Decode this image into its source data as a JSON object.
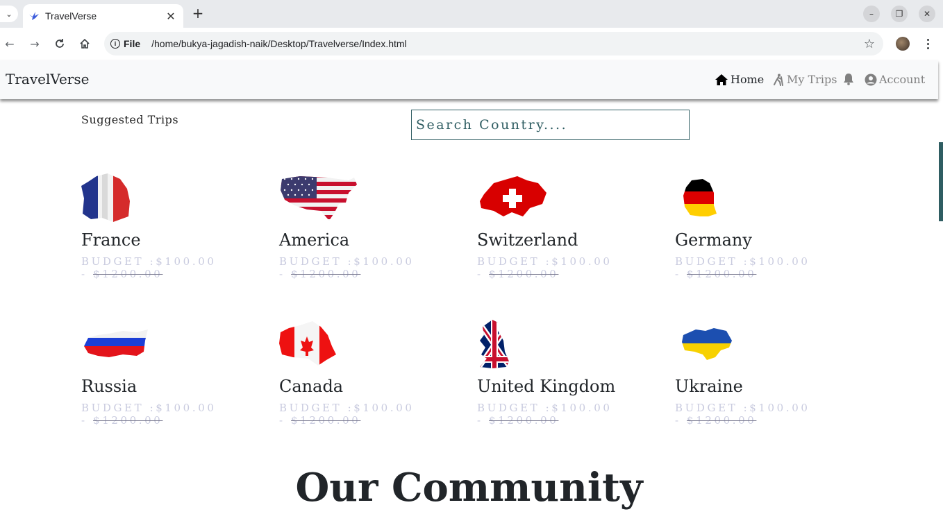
{
  "browser": {
    "tab_title": "TravelVerse",
    "new_tab_label": "+",
    "site_chip": "File",
    "url": "/home/bukya-jagadish-naik/Desktop/Travelverse/Index.html"
  },
  "site": {
    "brand": "TravelVerse",
    "nav": {
      "home": "Home",
      "my_trips": "My Trips",
      "account": "Account"
    },
    "suggested_heading": "Suggested Trips",
    "search_placeholder": "Search Country....",
    "trips": [
      {
        "name": "France",
        "budget_low": "BUDGET :$100.00 -",
        "budget_high": "$1200.00"
      },
      {
        "name": "America",
        "budget_low": "BUDGET :$100.00 -",
        "budget_high": "$1200.00"
      },
      {
        "name": "Switzerland",
        "budget_low": "BUDGET :$100.00 -",
        "budget_high": "$1200.00"
      },
      {
        "name": "Germany",
        "budget_low": "BUDGET :$100.00 -",
        "budget_high": "$1200.00"
      },
      {
        "name": "Russia",
        "budget_low": "BUDGET :$100.00 -",
        "budget_high": "$1200.00"
      },
      {
        "name": "Canada",
        "budget_low": "BUDGET :$100.00 -",
        "budget_high": "$1200.00"
      },
      {
        "name": "United Kingdom",
        "budget_low": "BUDGET :$100.00 -",
        "budget_high": "$1200.00"
      },
      {
        "name": "Ukraine",
        "budget_low": "BUDGET :$100.00 -",
        "budget_high": "$1200.00"
      }
    ],
    "community_heading": "Our Community"
  },
  "colors": {
    "accent": "#2f5d62",
    "budget_text": "#c9cbdf",
    "navbar_bg": "#f8f9fa"
  }
}
